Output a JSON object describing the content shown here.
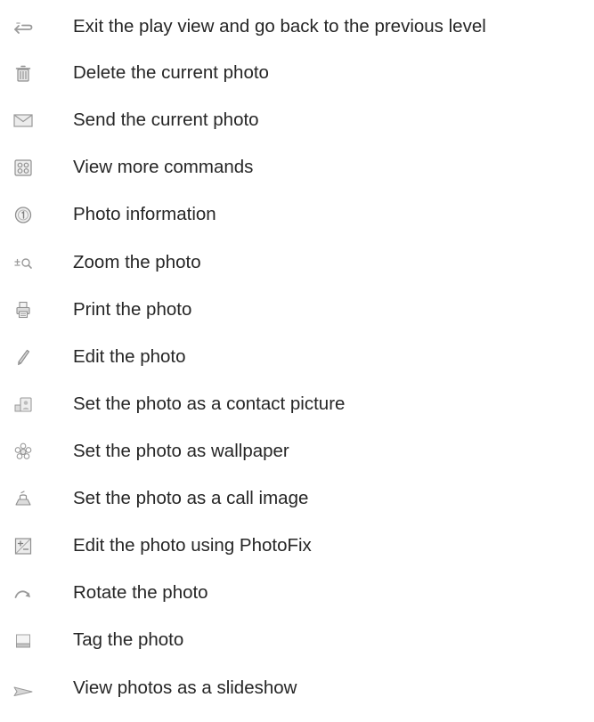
{
  "commands": [
    {
      "icon": "back-arrow-icon",
      "label": "Exit the play view and go back to the previous level"
    },
    {
      "icon": "trash-icon",
      "label": "Delete the current photo"
    },
    {
      "icon": "envelope-icon",
      "label": "Send the current photo"
    },
    {
      "icon": "more-commands-icon",
      "label": "View more commands"
    },
    {
      "icon": "info-icon",
      "label": "Photo information"
    },
    {
      "icon": "zoom-icon",
      "label": "Zoom the photo"
    },
    {
      "icon": "printer-icon",
      "label": "Print the photo"
    },
    {
      "icon": "pen-icon",
      "label": "Edit the photo"
    },
    {
      "icon": "contact-picture-icon",
      "label": "Set the photo as a contact picture"
    },
    {
      "icon": "wallpaper-icon",
      "label": "Set the photo as wallpaper"
    },
    {
      "icon": "call-image-icon",
      "label": "Set the photo as a call image"
    },
    {
      "icon": "photofix-icon",
      "label": "Edit the photo using PhotoFix"
    },
    {
      "icon": "rotate-icon",
      "label": "Rotate the photo"
    },
    {
      "icon": "tag-icon",
      "label": "Tag the photo"
    },
    {
      "icon": "slideshow-icon",
      "label": "View photos as a slideshow"
    }
  ]
}
